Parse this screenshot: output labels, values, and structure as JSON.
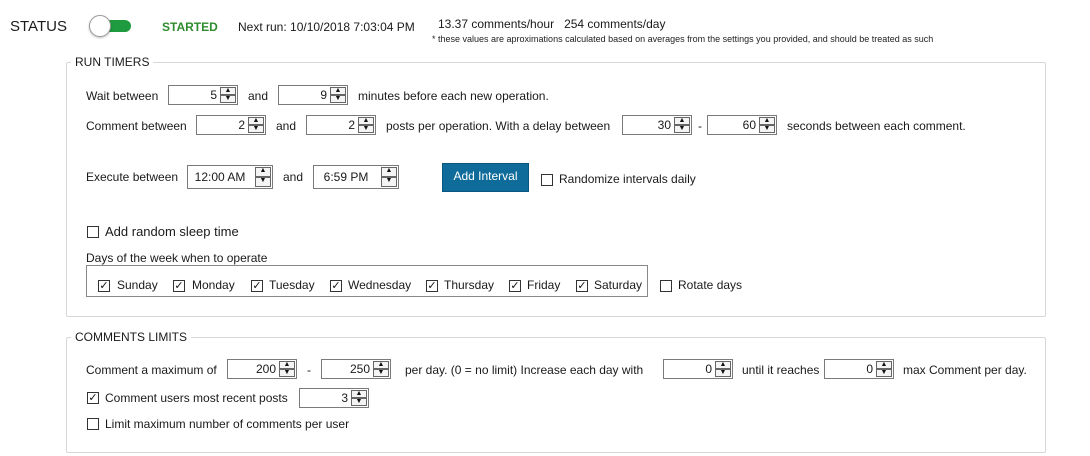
{
  "status": {
    "label": "STATUS",
    "state": "STARTED",
    "toggle_on": true,
    "next_run": "Next run: 10/10/2018 7:03:04 PM",
    "comments_per_hour": "13.37 comments/hour",
    "comments_per_day": "254 comments/day",
    "note": "* these values are aproximations calculated based on averages from the settings you provided, and should be treated as such"
  },
  "run_timers": {
    "legend": "RUN TIMERS",
    "wait": {
      "label": "Wait between",
      "min": "5",
      "and": "and",
      "max": "9",
      "suffix": "minutes before each new operation."
    },
    "comment": {
      "label": "Comment between",
      "min": "2",
      "and": "and",
      "max": "2",
      "mid": "posts per operation.  With a delay between",
      "delay_min": "30",
      "dash": "-",
      "delay_max": "60",
      "suffix": "seconds between each comment."
    },
    "execute": {
      "label": "Execute between",
      "start": "12:00 AM",
      "and": "and",
      "end": "6:59 PM",
      "add_interval": "Add Interval",
      "randomize": "Randomize intervals daily"
    },
    "sleep": {
      "label": "Add random sleep time",
      "checked": false
    },
    "days": {
      "label": "Days of the week when to operate",
      "items": [
        {
          "label": "Sunday",
          "checked": true
        },
        {
          "label": "Monday",
          "checked": true
        },
        {
          "label": "Tuesday",
          "checked": true
        },
        {
          "label": "Wednesday",
          "checked": true
        },
        {
          "label": "Thursday",
          "checked": true
        },
        {
          "label": "Friday",
          "checked": true
        },
        {
          "label": "Saturday",
          "checked": true
        }
      ],
      "rotate": "Rotate days"
    }
  },
  "comments_limits": {
    "legend": "COMMENTS LIMITS",
    "max": {
      "label": "Comment a maximum of",
      "min": "200",
      "dash": "-",
      "max": "250",
      "mid": "per day. (0 = no limit)   Increase each day with",
      "increase": "0",
      "until": "until it reaches",
      "reaches": "0",
      "suffix": "max Comment per day."
    },
    "recent": {
      "label": "Comment users most recent posts",
      "value": "3",
      "checked": true
    },
    "limit_per_user": {
      "label": "Limit maximum number of comments per user",
      "checked": false
    }
  },
  "icons": {
    "check": "✓",
    "spin_up": "▲",
    "spin_down": "▼"
  }
}
